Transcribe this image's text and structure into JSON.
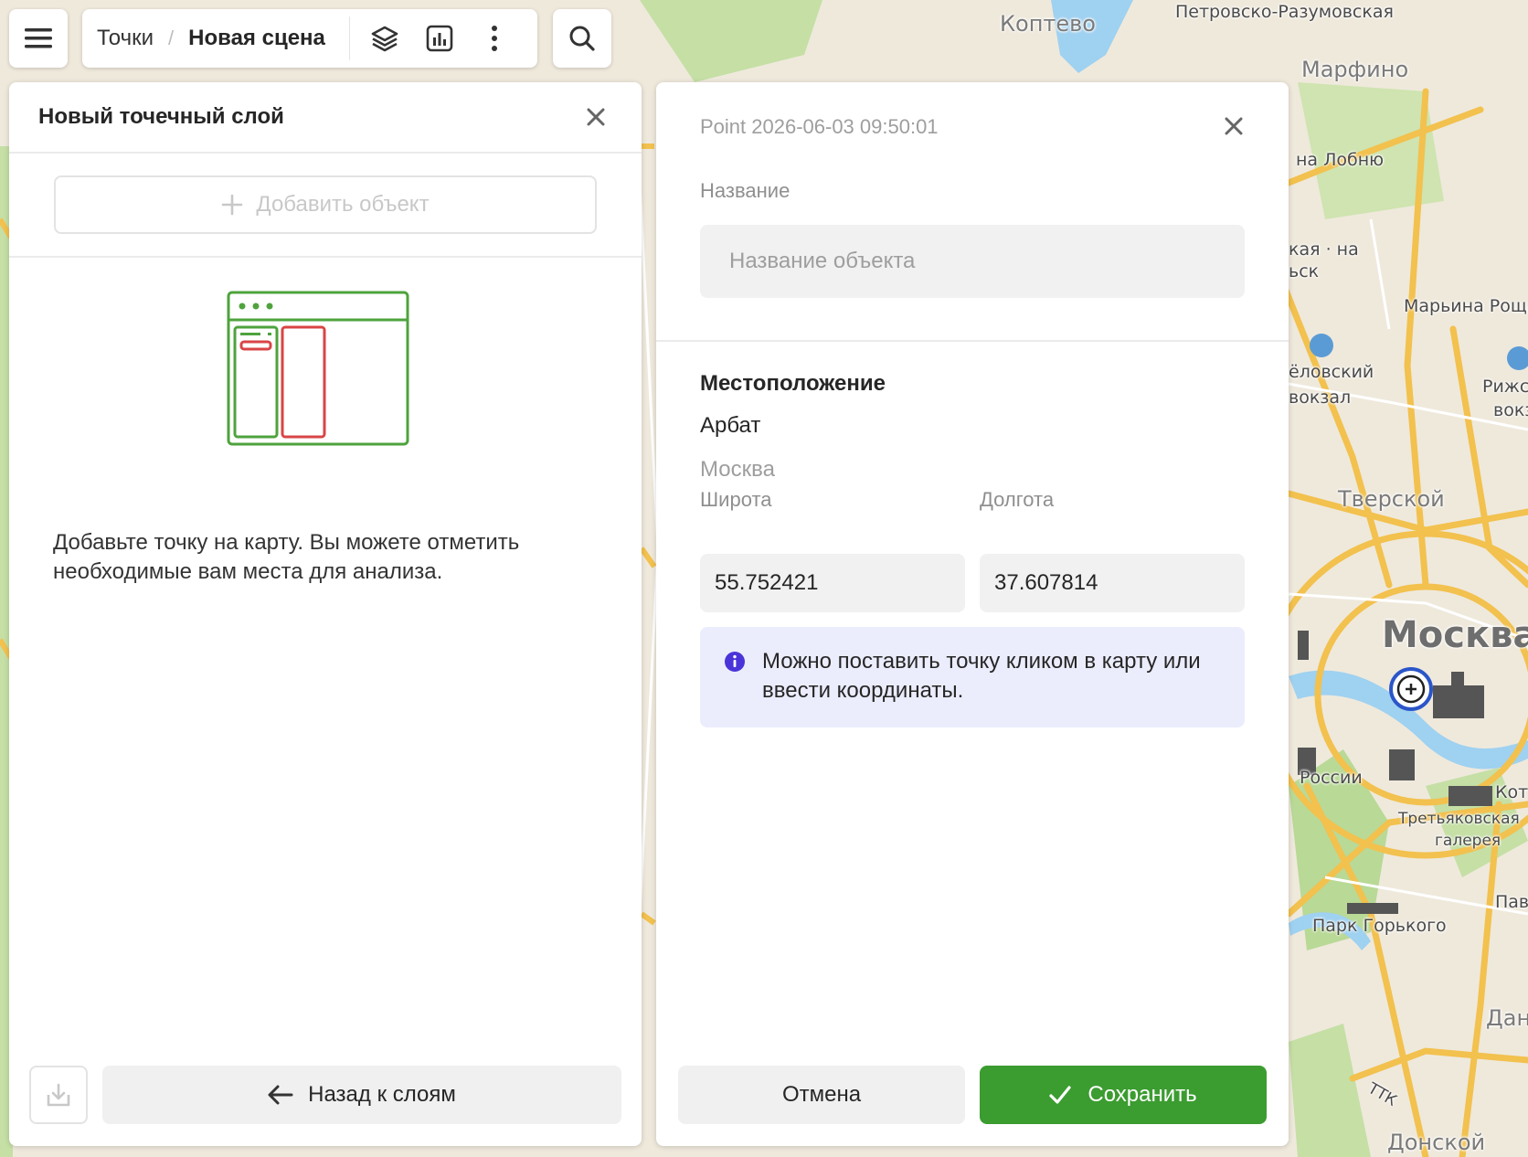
{
  "toolbar": {
    "menu_icon": "hamburger-icon",
    "breadcrumb_root": "Точки",
    "breadcrumb_separator": "/",
    "breadcrumb_current": "Новая сцена",
    "layers_icon": "layers-icon",
    "chart_icon": "chart-icon",
    "more_icon": "more-vertical-icon",
    "search_icon": "search-icon"
  },
  "left_panel": {
    "title": "Новый точечный слой",
    "add_object_label": "Добавить объект",
    "empty_text": "Добавьте точку на карту. Вы можете отметить необходимые вам места для анализа.",
    "back_label": "Назад к слоям",
    "download_icon": "download-icon"
  },
  "right_panel": {
    "header": "Point 2026-06-03 09:50:01",
    "name_label": "Название",
    "name_placeholder": "Название объекта",
    "location_title": "Местоположение",
    "location_name": "Арбат",
    "location_city": "Москва",
    "lat_label": "Широта",
    "lat_value": "55.752421",
    "lon_label": "Долгота",
    "lon_value": "37.607814",
    "hint_text": "Можно поставить точку кликом в карту или ввести координаты.",
    "cancel_label": "Отмена",
    "save_label": "Сохранить"
  },
  "map": {
    "labels": {
      "koptevo": "Коптево",
      "petrovsko": "Петровско-Разумовская",
      "marfino": "Марфино",
      "na_lobnyu": "на Лобню",
      "marina_roscha": "Марьина Роща",
      "belorussky": "ёловский",
      "vokzal": "вокзал",
      "rizhsky": "Рижс",
      "vokz": "вокз",
      "tverskoy": "Тверской",
      "moskva": "Москва",
      "rossii": "России",
      "tretyakov": "Третьяковская",
      "galereya": "галерея",
      "kot": "Кот",
      "park_gorkogo": "Парк Горького",
      "pav": "Пав",
      "dan": "Дан",
      "ttk": "ТТК",
      "donskoy": "Донской",
      "kaya_na": "кая · на",
      "lsk": "ьск"
    },
    "colors": {
      "land": "#efe9dc",
      "park": "#c5dfa5",
      "water": "#9fd1f0",
      "road_major": "#f2c14e",
      "road_minor": "#ffffff"
    },
    "marker_icon": "map-pin-plus-icon"
  },
  "colors": {
    "accent_green": "#3b9c30",
    "hint_bg": "#ebedfd",
    "info_icon": "#4a34d9"
  }
}
